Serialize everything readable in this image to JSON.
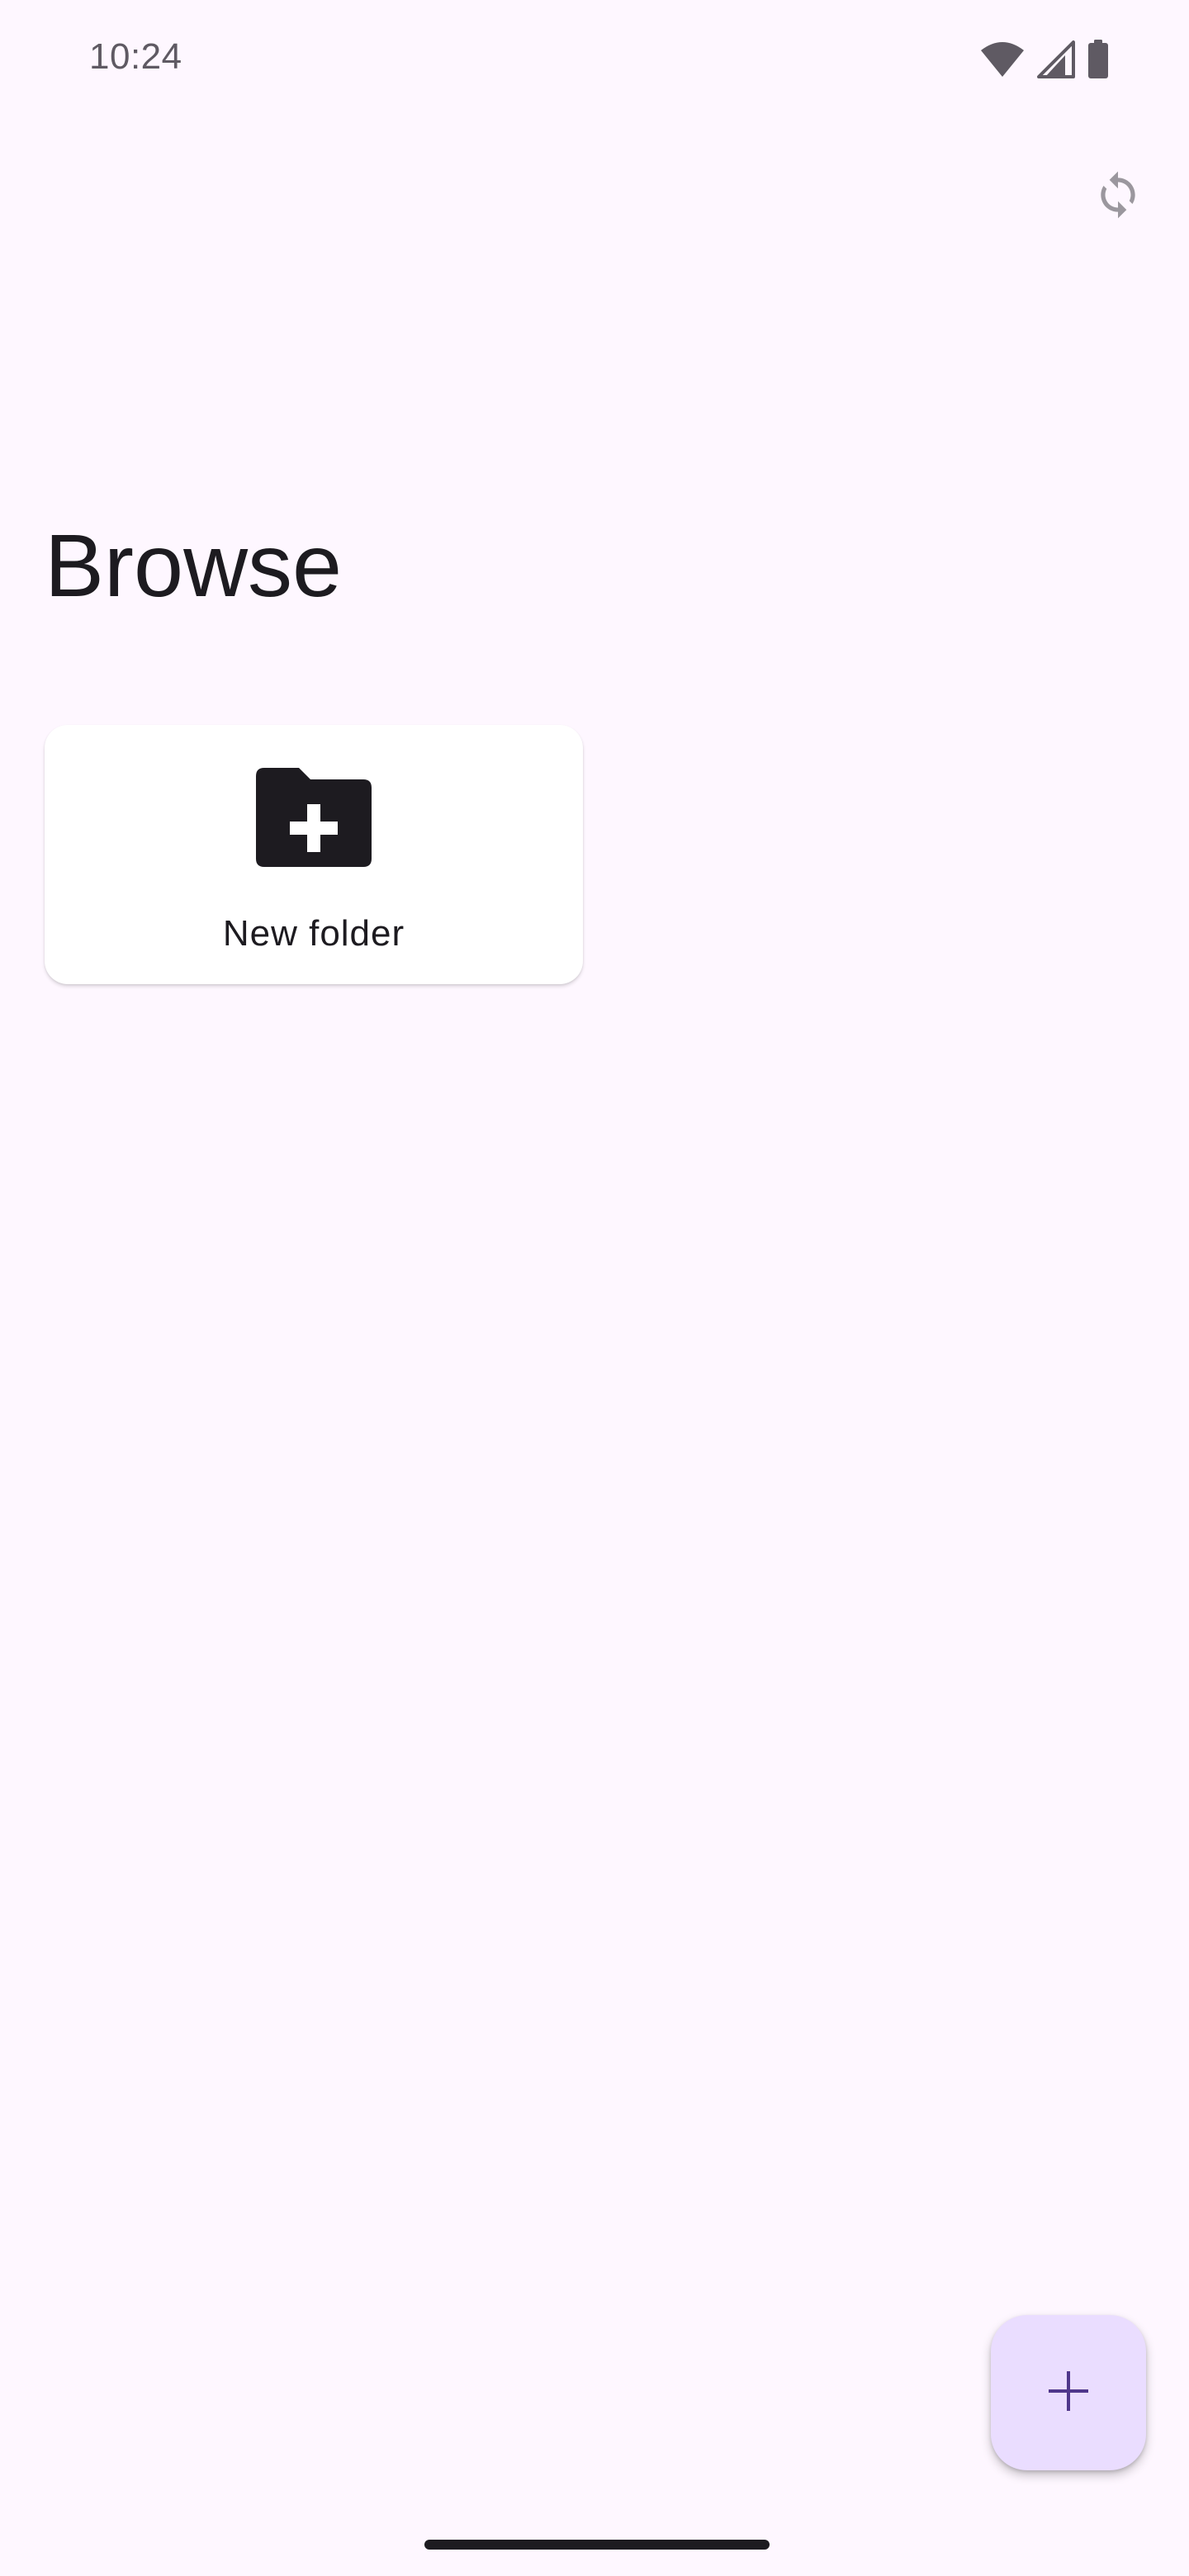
{
  "status_bar": {
    "time": "10:24",
    "icons": [
      "wifi-icon",
      "cell-signal-icon",
      "battery-icon"
    ]
  },
  "toolbar": {
    "sync_icon": "sync-icon"
  },
  "page": {
    "title": "Browse"
  },
  "cards": [
    {
      "label": "New folder",
      "icon": "create-new-folder-icon"
    }
  ],
  "fab": {
    "icon": "add-icon"
  },
  "colors": {
    "background": "#FEF7FF",
    "fab_background": "#EADDFF",
    "fab_icon": "#4F378B",
    "text_primary": "#1D1B20",
    "status_icons": "#5F5A63"
  }
}
